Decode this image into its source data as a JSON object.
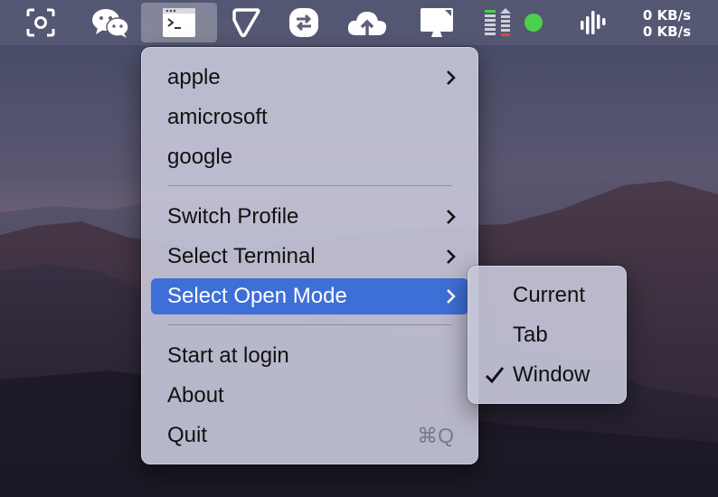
{
  "menubar": {
    "icons": [
      "screenshot-icon",
      "wechat-icon",
      "terminal-icon",
      "shortcut-app-icon",
      "connect-icon",
      "cloud-upload-icon",
      "display-icon",
      "stats-icon",
      "status-dot-icon",
      "audio-levels-icon"
    ],
    "net_up": "0 KB/s",
    "net_down": "0 KB/s"
  },
  "main_menu": {
    "items": [
      {
        "label": "apple",
        "submenu": true
      },
      {
        "label": "amicrosoft",
        "submenu": false
      },
      {
        "label": "google",
        "submenu": false
      },
      {
        "label": "Switch Profile",
        "submenu": true
      },
      {
        "label": "Select Terminal",
        "submenu": true
      },
      {
        "label": "Select Open Mode",
        "submenu": true,
        "highlighted": true
      },
      {
        "label": "Start at login",
        "submenu": false
      },
      {
        "label": "About",
        "submenu": false
      },
      {
        "label": "Quit",
        "shortcut": "⌘Q"
      }
    ]
  },
  "submenu": {
    "items": [
      {
        "label": "Current",
        "checked": false
      },
      {
        "label": "Tab",
        "checked": false
      },
      {
        "label": "Window",
        "checked": true
      }
    ]
  },
  "colors": {
    "highlight": "#3d6fd6",
    "status_green": "#4bd04b",
    "status_red": "#e0453a"
  }
}
